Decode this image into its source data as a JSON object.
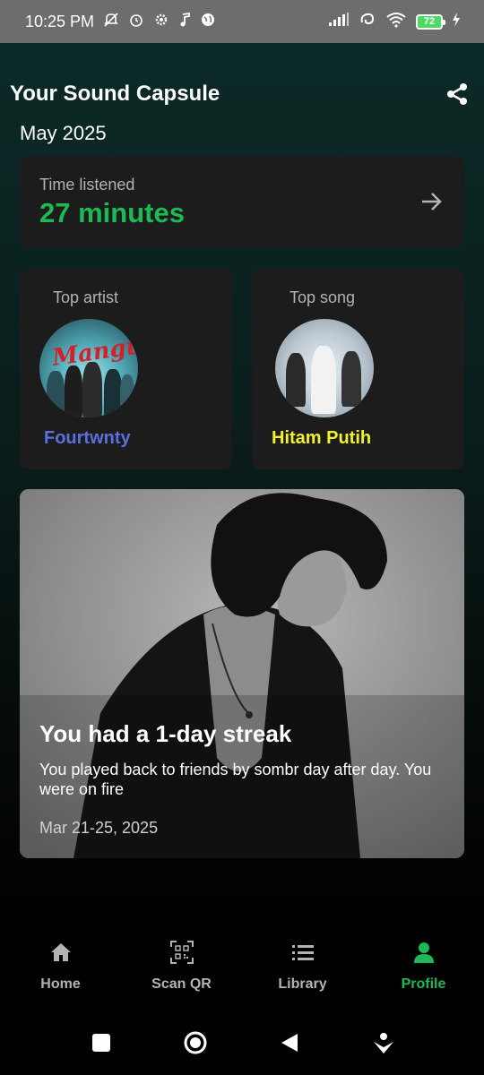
{
  "status_bar": {
    "time": "10:25 PM",
    "battery": "72"
  },
  "header": {
    "title": "Your Sound Capsule",
    "period": "May 2025"
  },
  "time_listened": {
    "label": "Time listened",
    "value": "27 minutes"
  },
  "top_artist": {
    "label": "Top artist",
    "name": "Fourtwnty",
    "cover_text": "Mangu"
  },
  "top_song": {
    "label": "Top song",
    "name": "Hitam Putih"
  },
  "streak": {
    "title": "You had a 1-day streak",
    "description": "You played back to friends by sombr day after day. You were on fire",
    "date": "Mar 21-25, 2025"
  },
  "nav": {
    "items": [
      {
        "label": "Home",
        "icon": "home-icon"
      },
      {
        "label": "Scan QR",
        "icon": "qr-icon"
      },
      {
        "label": "Library",
        "icon": "library-icon"
      },
      {
        "label": "Profile",
        "icon": "profile-icon"
      }
    ],
    "active": "Profile"
  },
  "colors": {
    "accent": "#1db954",
    "artist": "#5b6fe0",
    "song": "#f2f22a",
    "card": "#1c1c1c"
  }
}
